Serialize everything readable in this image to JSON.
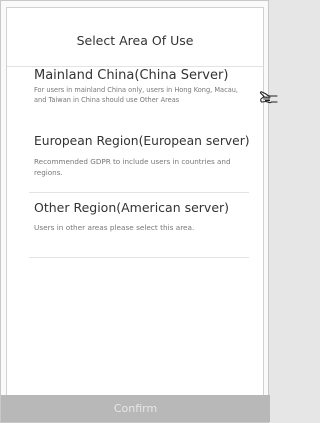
{
  "header": {
    "title": "Select Area Of Use"
  },
  "options": [
    {
      "title": "Mainland China(China Server)",
      "description": "For users in mainland China only, users in Hong Kong, Macau, and Taiwan in China should use Other Areas"
    },
    {
      "title": "European Region(European server)",
      "description": "Recommended GDPR to include users in countries and regions."
    },
    {
      "title": "Other Region(American server)",
      "description": "Users in other areas please select this area."
    }
  ],
  "footer": {
    "confirm_label": "Confirm",
    "confirm_state": "disabled"
  },
  "icons": {
    "pointer": "hand-pointer-icon"
  },
  "colors": {
    "confirm_background": "#b8b8b8",
    "confirm_text": "#e7e7e7",
    "title_text": "#333333",
    "description_text": "#777777"
  }
}
